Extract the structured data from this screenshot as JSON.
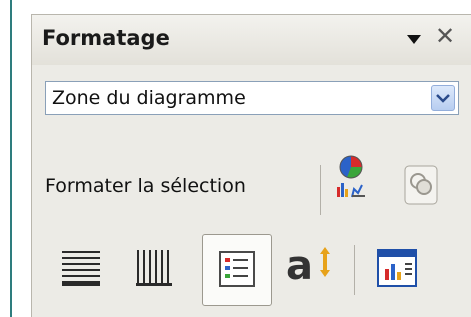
{
  "panel": {
    "title": "Formatage",
    "menu_icon": "dropdown-arrow-icon",
    "close_icon": "close-icon"
  },
  "selector": {
    "value": "Zone du diagramme",
    "button_icon": "chevron-down-icon"
  },
  "format_selection": {
    "label": "Formater la sélection",
    "icons": [
      "chart-format-icon",
      "copy-format-icon"
    ]
  },
  "toolbar": {
    "icons": [
      "horizontal-grid-icon",
      "vertical-grid-icon",
      "legend-icon",
      "title-text-icon",
      "data-table-icon"
    ],
    "active": "legend-icon"
  },
  "colors": {
    "panel_bg": "#ecebe6",
    "accent_rule": "#2e7d7e",
    "select_border": "#8aa0b8"
  }
}
